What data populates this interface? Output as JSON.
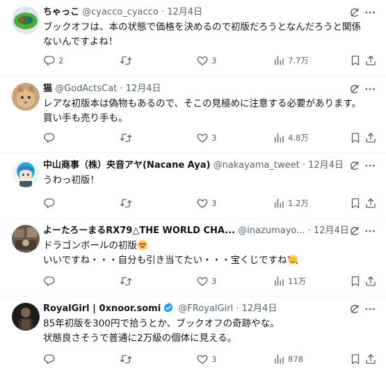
{
  "tweets": [
    {
      "name": "ちゃっこ",
      "handle": "@cyacco_cyacco",
      "sep": "·",
      "date": "12月4日",
      "text": [
        "ブックオフは、本の状態で価格を決めるので初版だろうとなんだろうと関係",
        "ないんですよね！"
      ],
      "replies": "2",
      "retweets": "",
      "likes": "3",
      "views": "7.7万"
    },
    {
      "name": "猫",
      "handle": "@GodActsCat",
      "sep": "·",
      "date": "12月4日",
      "text": [
        "レアな初版本は偽物もあるので、そこの見極めに注意する必要があります。",
        "買い手も売り手も。"
      ],
      "replies": "",
      "retweets": "",
      "likes": "3",
      "views": "4.8万"
    },
    {
      "name": "中山商事（株）央音アヤ(Nacane Aya)",
      "handle": "@nakayama_tweet",
      "sep": "·",
      "date": "12月4日",
      "text": [
        "うわっ初版！"
      ],
      "replies": "",
      "retweets": "",
      "likes": "3",
      "views": "1.2万"
    },
    {
      "name": "よーたろーまるRX79△THE WORLD CHA...",
      "handle": "@inazumayo...",
      "sep": "·",
      "date": "12月4日",
      "text": [
        "ドラゴンボールの初版",
        "いいですね・・・自分も引き当てたい・・・宝くじですね"
      ],
      "replies": "",
      "retweets": "",
      "likes": "3",
      "views": "11万"
    },
    {
      "name": "RoyalGirl | 0xnoor.somi",
      "handle": "@FRoyalGirl",
      "sep": "·",
      "date": "12月4日",
      "text": [
        "85年初版を300円で拾うとか、ブックオフの奇跡やな。",
        "状態良さそうで普通に2万級の個体に見える。"
      ],
      "replies": "",
      "retweets": "",
      "likes": "3",
      "views": "878"
    }
  ],
  "icons": {
    "reply": "reply-icon",
    "retweet": "retweet-icon",
    "like": "heart-icon",
    "views": "views-icon",
    "bookmark": "bookmark-icon",
    "share": "share-icon",
    "grok": "grok-icon",
    "more": "more-icon",
    "verified": "verified-badge-icon",
    "emoji_heart_eyes": "heart-eyes-emoji",
    "emoji_hearts_face": "smiling-face-with-hearts-emoji"
  },
  "colors": {
    "text": "#0f1419",
    "secondary": "#536471",
    "divider": "#eff3f4",
    "verified": "#1d9bf0"
  }
}
